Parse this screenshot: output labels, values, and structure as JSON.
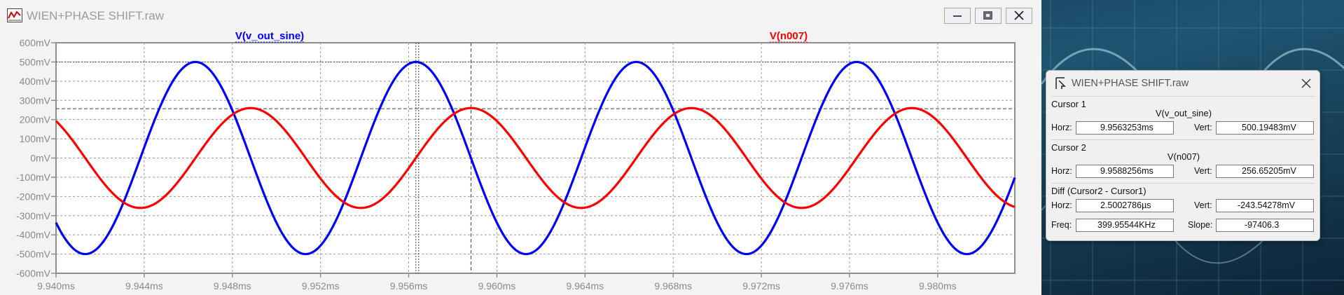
{
  "window": {
    "title": "WIEN+PHASE SHIFT.raw",
    "buttons": [
      "minimize",
      "maximize",
      "close"
    ]
  },
  "plot": {
    "traces": [
      {
        "name": "V(v_out_sine)",
        "color": "#0000ff"
      },
      {
        "name": "V(n007)",
        "color": "#ff0000"
      }
    ]
  },
  "chart_data": {
    "type": "line",
    "title": "",
    "xlabel": "",
    "ylabel": "",
    "xlim": [
      9.94,
      9.9835
    ],
    "ylim": [
      -600,
      600
    ],
    "x_unit": "ms",
    "y_unit": "mV",
    "grid": true,
    "xticks": [
      "9.940ms",
      "9.944ms",
      "9.948ms",
      "9.952ms",
      "9.956ms",
      "9.960ms",
      "9.964ms",
      "9.968ms",
      "9.972ms",
      "9.976ms",
      "9.980ms"
    ],
    "xtick_values": [
      9.94,
      9.944,
      9.948,
      9.952,
      9.956,
      9.96,
      9.964,
      9.968,
      9.972,
      9.976,
      9.98
    ],
    "yticks": [
      "600mV",
      "500mV",
      "400mV",
      "300mV",
      "200mV",
      "100mV",
      "0mV",
      "-100mV",
      "-200mV",
      "-300mV",
      "-400mV",
      "-500mV",
      "-600mV"
    ],
    "ytick_values": [
      600,
      500,
      400,
      300,
      200,
      100,
      0,
      -100,
      -200,
      -300,
      -400,
      -500,
      -600
    ],
    "series": [
      {
        "name": "V(v_out_sine)",
        "color": "#0000ff",
        "amplitude": 500,
        "frequency_khz": 100,
        "peak_time": 9.9563253
      },
      {
        "name": "V(n007)",
        "color": "#ff0000",
        "amplitude": 260,
        "frequency_khz": 100,
        "peak_time": 9.9588256
      }
    ],
    "cursors": [
      {
        "name": "Cursor 1",
        "x": 9.9563253,
        "y": 500.19483
      },
      {
        "name": "Cursor 2",
        "x": 9.9588256,
        "y": 256.65205
      }
    ]
  },
  "cursor_dialog": {
    "title": "WIEN+PHASE SHIFT.raw",
    "cursor1": {
      "heading": "Cursor 1",
      "trace": "V(v_out_sine)",
      "horz_label": "Horz:",
      "horz": "9.9563253ms",
      "vert_label": "Vert:",
      "vert": "500.19483mV"
    },
    "cursor2": {
      "heading": "Cursor 2",
      "trace": "V(n007)",
      "horz_label": "Horz:",
      "horz": "9.9588256ms",
      "vert_label": "Vert:",
      "vert": "256.65205mV"
    },
    "diff": {
      "heading": "Diff (Cursor2 - Cursor1)",
      "horz_label": "Horz:",
      "horz": "2.5002786µs",
      "vert_label": "Vert:",
      "vert": "-243.54278mV",
      "freq_label": "Freq:",
      "freq": "399.95544KHz",
      "slope_label": "Slope:",
      "slope": "-97406.3"
    }
  }
}
